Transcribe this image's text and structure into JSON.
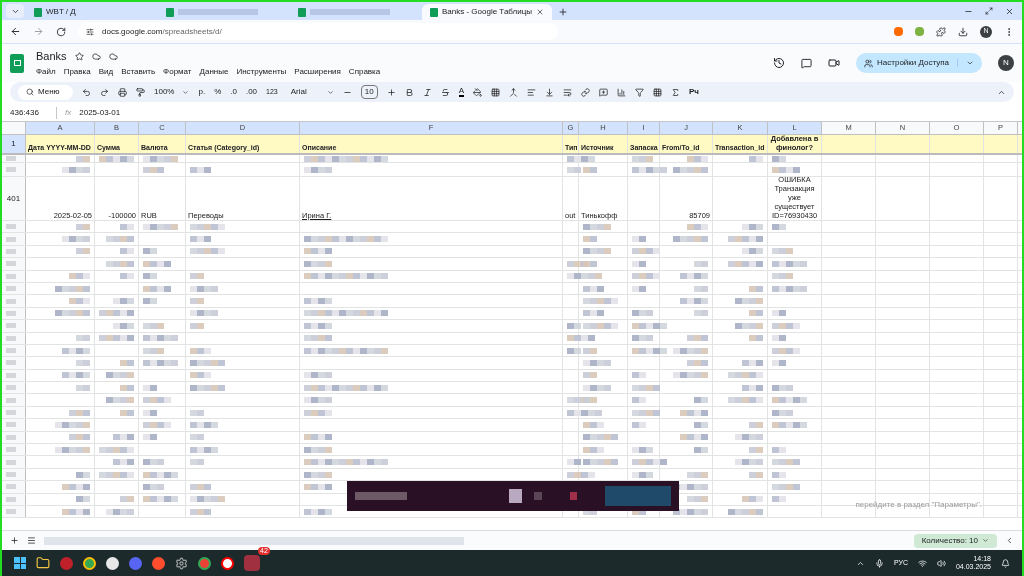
{
  "browser": {
    "tabs": [
      {
        "title": "WBT / Д",
        "selected": false
      },
      {
        "selected": false
      },
      {
        "selected": false
      },
      {
        "title": "Banks - Google Таблицы",
        "selected": true
      }
    ],
    "address": {
      "host": "docs.google.com",
      "path": "/spreadsheets/d/"
    },
    "profile": "N"
  },
  "app": {
    "title": "Banks",
    "menu": [
      "Файл",
      "Правка",
      "Вид",
      "Вставить",
      "Формат",
      "Данные",
      "Инструменты",
      "Расширения",
      "Справка"
    ],
    "share_button": "Настройки Доступа",
    "avatar": "N"
  },
  "toolbar": {
    "search": "Меню",
    "zoom": "100%",
    "currency": "р.",
    "percent": "%",
    "decrease_decimals": ".0",
    "increase_decimals": ".00",
    "format": "123",
    "font": "Arial",
    "font_size": "10",
    "text_color": "A",
    "input_tools": "Рч"
  },
  "formula_bar": {
    "cell_ref": "436:436",
    "fx": "fx",
    "value": "2025-03-01"
  },
  "sheet": {
    "columns": [
      "A",
      "B",
      "C",
      "D",
      "F",
      "G",
      "H",
      "I",
      "J",
      "K",
      "L",
      "M",
      "N",
      "O",
      "P"
    ],
    "header_row": {
      "number": "1",
      "cells": [
        "Дата YYYY-MM-DD",
        "Сумма",
        "Валюта",
        "Статья (Category_id)",
        "Описание",
        "Тип",
        "Источник",
        "Запаска",
        "From/To_id",
        "Transaction_id",
        "Добавлена в финолог?",
        "",
        "",
        "",
        ""
      ]
    },
    "row": {
      "number": "401",
      "cells": [
        "2025-02-05",
        "-100000",
        "RUB",
        "Переводы",
        "Ирина Г.",
        "out",
        "Тинькофф",
        "",
        "85709",
        "",
        "ОШИБКА Транзакция уже существует ID=76930430",
        "",
        "",
        "",
        ""
      ]
    }
  },
  "notice": "перейдите в раздел \"Параметры\".",
  "sheet_bar": {
    "count": "Количество: 10"
  },
  "taskbar": {
    "badge": "42",
    "language": "РУС",
    "time": "14:18",
    "date": "04.03.2025"
  }
}
